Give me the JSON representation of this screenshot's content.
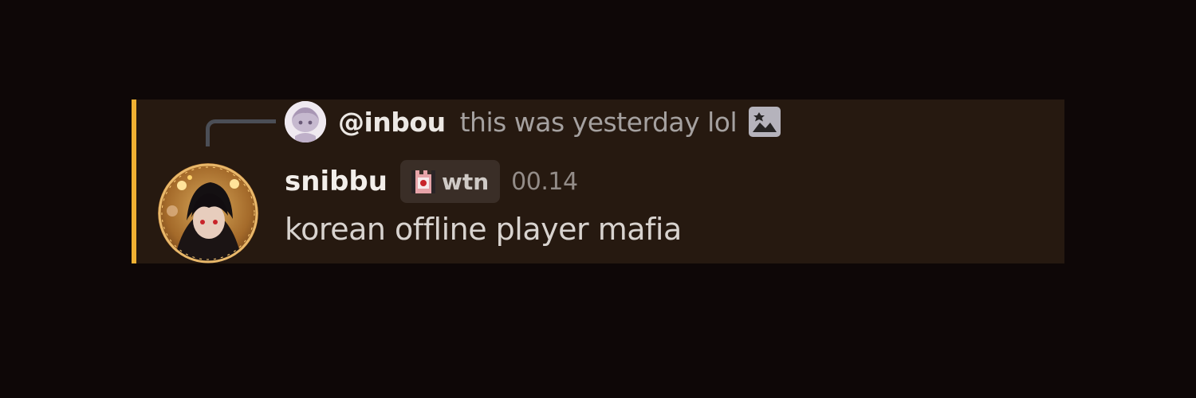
{
  "message": {
    "reply": {
      "author": "@inbou",
      "content": "this was yesterday lol",
      "attachment_icon": "image-icon"
    },
    "author": {
      "username": "snibbu",
      "tag": {
        "icon": "tag-castle-icon",
        "label": "wtn"
      },
      "avatar": "avatar"
    },
    "timestamp": "00.14",
    "content": "korean offline player mafia"
  },
  "colors": {
    "background": "#0e0707",
    "message_highlight": "#261910",
    "mention_bar": "#f0b132",
    "reply_spine": "#4b4e56",
    "tag_background": "#3a2e27"
  }
}
